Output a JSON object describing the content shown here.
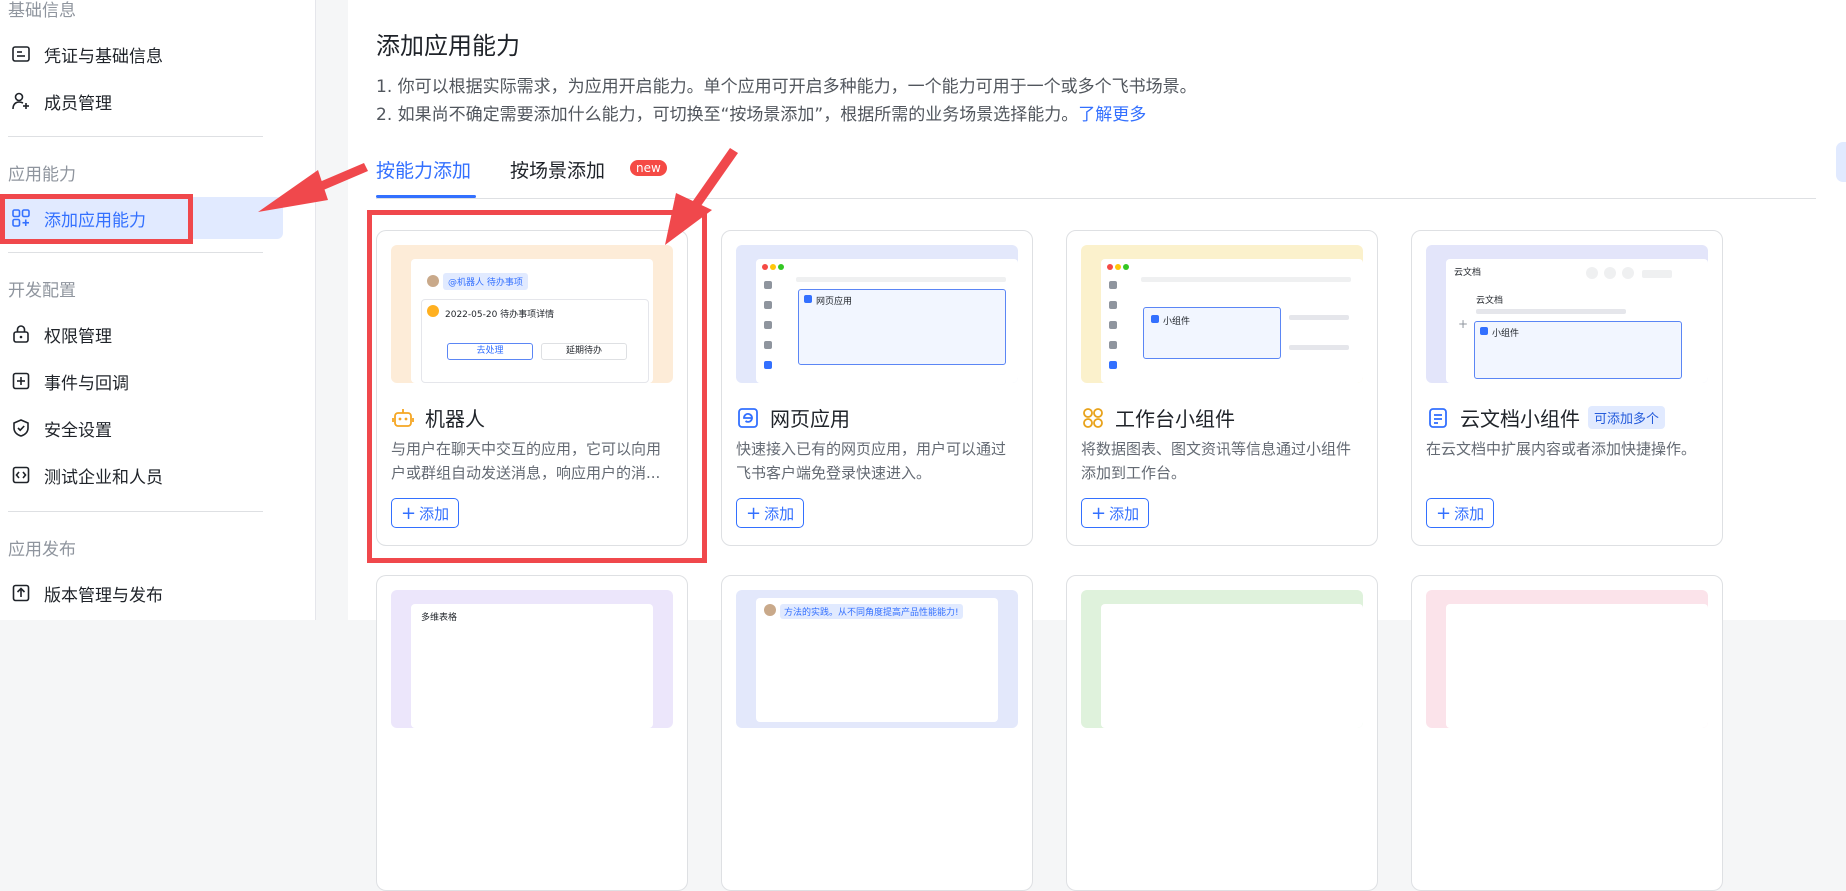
{
  "sidebar": {
    "groups": [
      {
        "label": "基础信息"
      },
      {
        "label": "应用能力"
      },
      {
        "label": "开发配置"
      },
      {
        "label": "应用发布"
      }
    ],
    "items": [
      {
        "label": "凭证与基础信息",
        "icon": "id-card-icon"
      },
      {
        "label": "成员管理",
        "icon": "user-add-icon"
      },
      {
        "label": "添加应用能力",
        "icon": "apps-add-icon",
        "active": true
      },
      {
        "label": "权限管理",
        "icon": "lock-icon"
      },
      {
        "label": "事件与回调",
        "icon": "event-icon"
      },
      {
        "label": "安全设置",
        "icon": "shield-icon"
      },
      {
        "label": "测试企业和人员",
        "icon": "code-icon"
      },
      {
        "label": "版本管理与发布",
        "icon": "upload-icon"
      }
    ]
  },
  "main": {
    "title": "添加应用能力",
    "desc1": "1. 你可以根据实际需求，为应用开启能力。单个应用可开启多种能力，一个能力可用于一个或多个飞书场景。",
    "desc2": "2. 如果尚不确定需要添加什么能力，可切换至“按场景添加”，根据所需的业务场景选择能力。",
    "learn_more": "了解更多",
    "tabs": [
      {
        "label": "按能力添加",
        "active": true
      },
      {
        "label": "按场景添加",
        "badge": "new"
      }
    ]
  },
  "cards": [
    {
      "title": "机器人",
      "icon": "robot-icon",
      "desc": "与用户在聊天中交互的应用，它可以向用户或群组自动发送消息，响应用户的消...",
      "add": "添加",
      "preview": {
        "chip": "@机器人  待办事项",
        "line": "2022-05-20 待办事项详情",
        "btn1": "去处理",
        "btn2": "延期待办"
      }
    },
    {
      "title": "网页应用",
      "icon": "web-icon",
      "desc": "快速接入已有的网页应用，用户可以通过飞书客户端免登录快速进入。",
      "add": "添加",
      "preview": {
        "label": "网页应用"
      }
    },
    {
      "title": "工作台小组件",
      "icon": "widget-icon",
      "desc": "将数据图表、图文资讯等信息通过小组件添加到工作台。",
      "add": "添加",
      "preview": {
        "label": "小组件"
      }
    },
    {
      "title": "云文档小组件",
      "icon": "doc-icon",
      "tag": "可添加多个",
      "desc": "在云文档中扩展内容或者添加快捷操作。",
      "add": "添加",
      "preview": {
        "header": "云文档",
        "sub": "云文档",
        "label": "小组件"
      }
    }
  ],
  "row2_previews": [
    {
      "label": "多维表格"
    },
    {
      "label": "方法的实践。从不同角度提高产品性能能力!"
    },
    {
      "label": ""
    },
    {
      "label": ""
    }
  ],
  "colors": {
    "accent": "#3370ff",
    "annotation": "#f0484c"
  }
}
